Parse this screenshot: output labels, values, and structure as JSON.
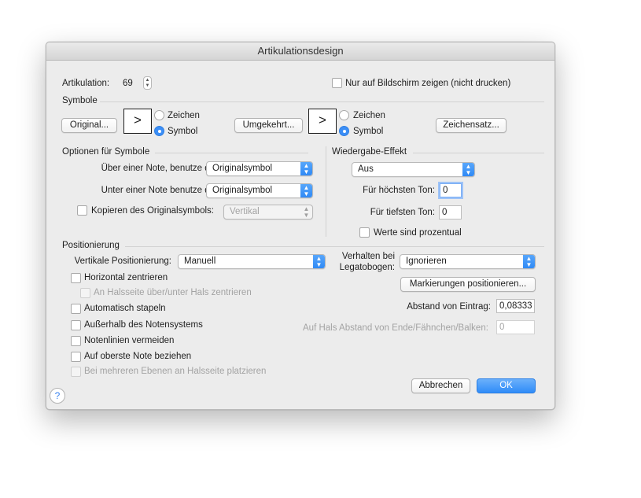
{
  "window": {
    "title": "Artikulationsdesign"
  },
  "top": {
    "articulation_label": "Artikulation:",
    "articulation_value": "69",
    "screen_only_label": "Nur auf Bildschirm zeigen (nicht drucken)"
  },
  "symbols": {
    "section_label": "Symbole",
    "original_button": "Original...",
    "original_symbol": ">",
    "zeichen_label": "Zeichen",
    "symbol_label": "Symbol",
    "reversed_button": "Umgekehrt...",
    "reversed_symbol": ">",
    "zeichen_label_2": "Zeichen",
    "symbol_label_2": "Symbol",
    "charset_button": "Zeichensatz..."
  },
  "symbol_options": {
    "section_label": "Optionen für Symbole",
    "above_label": "Über einer Note, benutze das:",
    "above_value": "Originalsymbol",
    "below_label": "Unter einer Note benutze das:",
    "below_value": "Originalsymbol",
    "copy_label": "Kopieren des Originalsymbols:",
    "copy_value": "Vertikal"
  },
  "playback": {
    "section_label": "Wiedergabe-Effekt",
    "effect_value": "Aus",
    "top_note_label": "Für höchsten Ton:",
    "top_note_value": "0",
    "bottom_note_label": "Für tiefsten Ton:",
    "bottom_note_value": "0",
    "percent_label": "Werte sind prozentual"
  },
  "positioning": {
    "section_label": "Positionierung",
    "vertical_label": "Vertikale Positionierung:",
    "vertical_value": "Manuell",
    "legato_label_1": "Verhalten bei",
    "legato_label_2": "Legatobogen:",
    "legato_value": "Ignorieren",
    "mark_positions_button": "Markierungen positionieren...",
    "distance_label": "Abstand von Eintrag:",
    "distance_value": "0,08333",
    "stem_distance_label": "Auf Hals Abstand von Ende/Fähnchen/Balken:",
    "stem_distance_value": "0",
    "options": {
      "center_horizontally": "Horizontal zentrieren",
      "center_stem_side": "An Halsseite über/unter Hals zentrieren",
      "auto_stack": "Automatisch stapeln",
      "outside_staff": "Außerhalb des Notensystems",
      "avoid_staff_lines": "Notenlinien vermeiden",
      "top_note": "Auf oberste Note beziehen",
      "multi_layer": "Bei mehreren Ebenen an Halsseite platzieren"
    }
  },
  "footer": {
    "help_glyph": "?",
    "cancel_button": "Abbrechen",
    "ok_button": "OK"
  },
  "icons": {
    "help": "help-icon",
    "select_arrows": "updown-chevron-icon",
    "stepper": "stepper-icon"
  },
  "colors": {
    "accent": "#2f8cf8",
    "window_bg": "#ececec"
  }
}
